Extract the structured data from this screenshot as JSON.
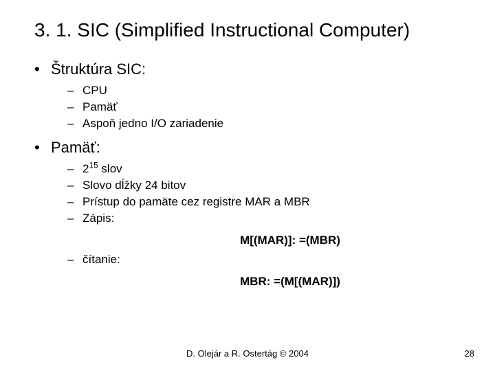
{
  "title": "3. 1. SIC (Simplified Instructional Computer)",
  "b1": {
    "heading": "Štruktúra SIC:",
    "items": [
      "CPU",
      "Pamäť",
      "Aspoň jedno I/O zariadenie"
    ]
  },
  "b2": {
    "heading": "Pamäť:",
    "word_base": "2",
    "word_exp": "15",
    "word_tail": " slov",
    "items": [
      "Slovo dĺžky 24 bitov",
      "Prístup do pamäte cez registre MAR a MBR",
      "Zápis:"
    ],
    "formula1": "M[(MAR)]: =(MBR)",
    "read_label": "čítanie:",
    "formula2": "MBR: =(M[(MAR)])"
  },
  "footer": "D. Olejár a R. Ostertág © 2004",
  "page": "28"
}
